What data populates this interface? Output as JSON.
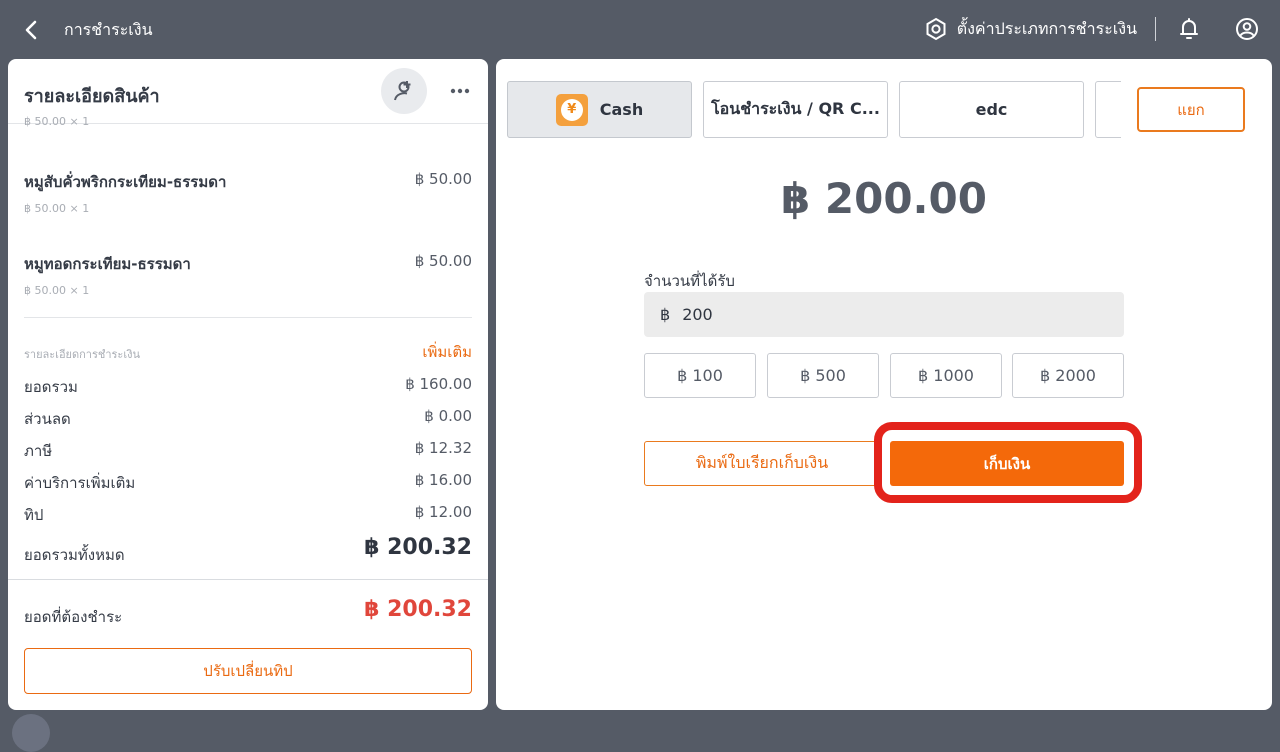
{
  "header": {
    "title": "การชำระเงิน",
    "settings_label": "ตั้งค่าประเภทการชำระเงิน"
  },
  "order": {
    "title": "รายละเอียดสินค้า",
    "cut_line": "฿ 50.00 × 1",
    "items": [
      {
        "name": "หมูสับคั่วพริกกระเทียม-ธรรมดา",
        "price": "฿ 50.00",
        "qty": "฿ 50.00 × 1"
      },
      {
        "name": "หมูทอดกระเทียม-ธรรมดา",
        "price": "฿ 50.00",
        "qty": "฿ 50.00 × 1"
      }
    ]
  },
  "payment_details": {
    "label": "รายละเอียดการชำระเงิน",
    "more_label": "เพิ่มเติม",
    "rows": [
      {
        "label": "ยอดรวม",
        "value": "฿ 160.00"
      },
      {
        "label": "ส่วนลด",
        "value": "฿ 0.00"
      },
      {
        "label": "ภาษี",
        "value": "฿ 12.32"
      },
      {
        "label": "ค่าบริการเพิ่มเติม",
        "value": "฿ 16.00"
      },
      {
        "label": "ทิป",
        "value": "฿ 12.00"
      }
    ],
    "grand_total_label": "ยอดรวมทั้งหมด",
    "grand_total_value": "฿ 200.32",
    "due_label": "ยอดที่ต้องชำระ",
    "due_value": "฿ 200.32",
    "adjust_tip_label": "ปรับเปลี่ยนทิป"
  },
  "payment": {
    "methods": [
      {
        "label": "Cash",
        "icon": "yen-coin-icon",
        "icon_glyph": "¥",
        "active": true
      },
      {
        "label": "โอนชำระเงิน / QR C...",
        "active": false
      },
      {
        "label": "edc",
        "active": false
      },
      {
        "label": "",
        "active": false
      }
    ],
    "split_label": "แยก",
    "amount": "฿ 200.00",
    "received_label": "จำนวนที่ได้รับ",
    "currency": "฿",
    "received_value": "200",
    "quick_amounts": [
      "฿ 100",
      "฿ 500",
      "฿ 1000",
      "฿ 2000"
    ],
    "print_label": "พิมพ์ใบเรียกเก็บเงิน",
    "collect_label": "เก็บเงิน"
  },
  "colors": {
    "accent": "#f4690a",
    "highlight": "#e3231b",
    "due": "#e0463b",
    "topbar": "#555b66"
  }
}
